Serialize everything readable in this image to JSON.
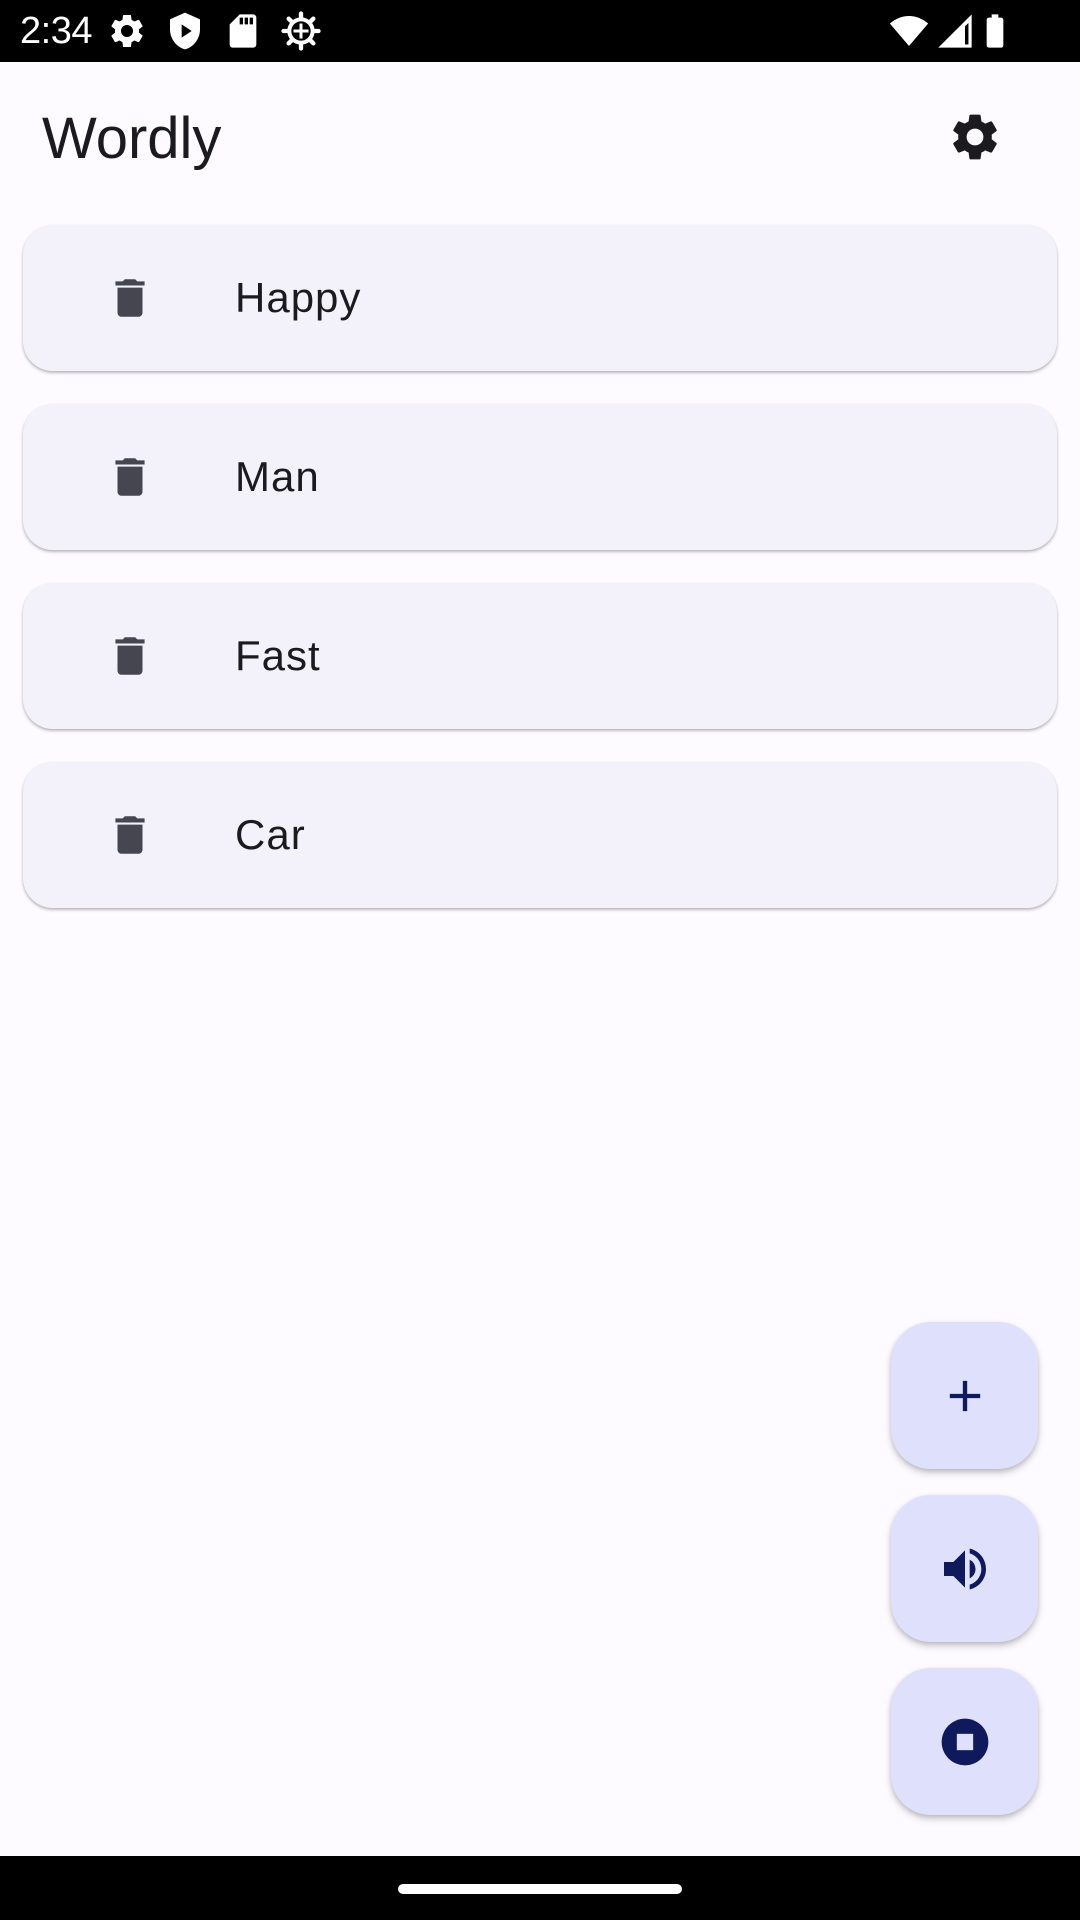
{
  "status_bar": {
    "time": "2:34",
    "left_icons": [
      "settings-icon",
      "shield-play-icon",
      "sd-card-icon",
      "debug-gear-icon"
    ],
    "right_icons": [
      "wifi-icon",
      "signal-icon",
      "battery-icon"
    ]
  },
  "app_bar": {
    "title": "Wordly",
    "settings_icon": "settings-icon"
  },
  "words": [
    {
      "label": "Happy",
      "icon": "delete-icon"
    },
    {
      "label": "Man",
      "icon": "delete-icon"
    },
    {
      "label": "Fast",
      "icon": "delete-icon"
    },
    {
      "label": "Car",
      "icon": "delete-icon"
    }
  ],
  "fabs": [
    {
      "name": "add",
      "icon": "plus-icon"
    },
    {
      "name": "speak",
      "icon": "volume-up-icon"
    },
    {
      "name": "stop",
      "icon": "stop-circle-icon"
    }
  ],
  "colors": {
    "background": "#fdfbff",
    "card": "#f3f2fa",
    "fab": "#dfe0fb",
    "fab_icon": "#0e1a5c",
    "delete_icon": "#45464f",
    "text": "#1b1b1f"
  }
}
